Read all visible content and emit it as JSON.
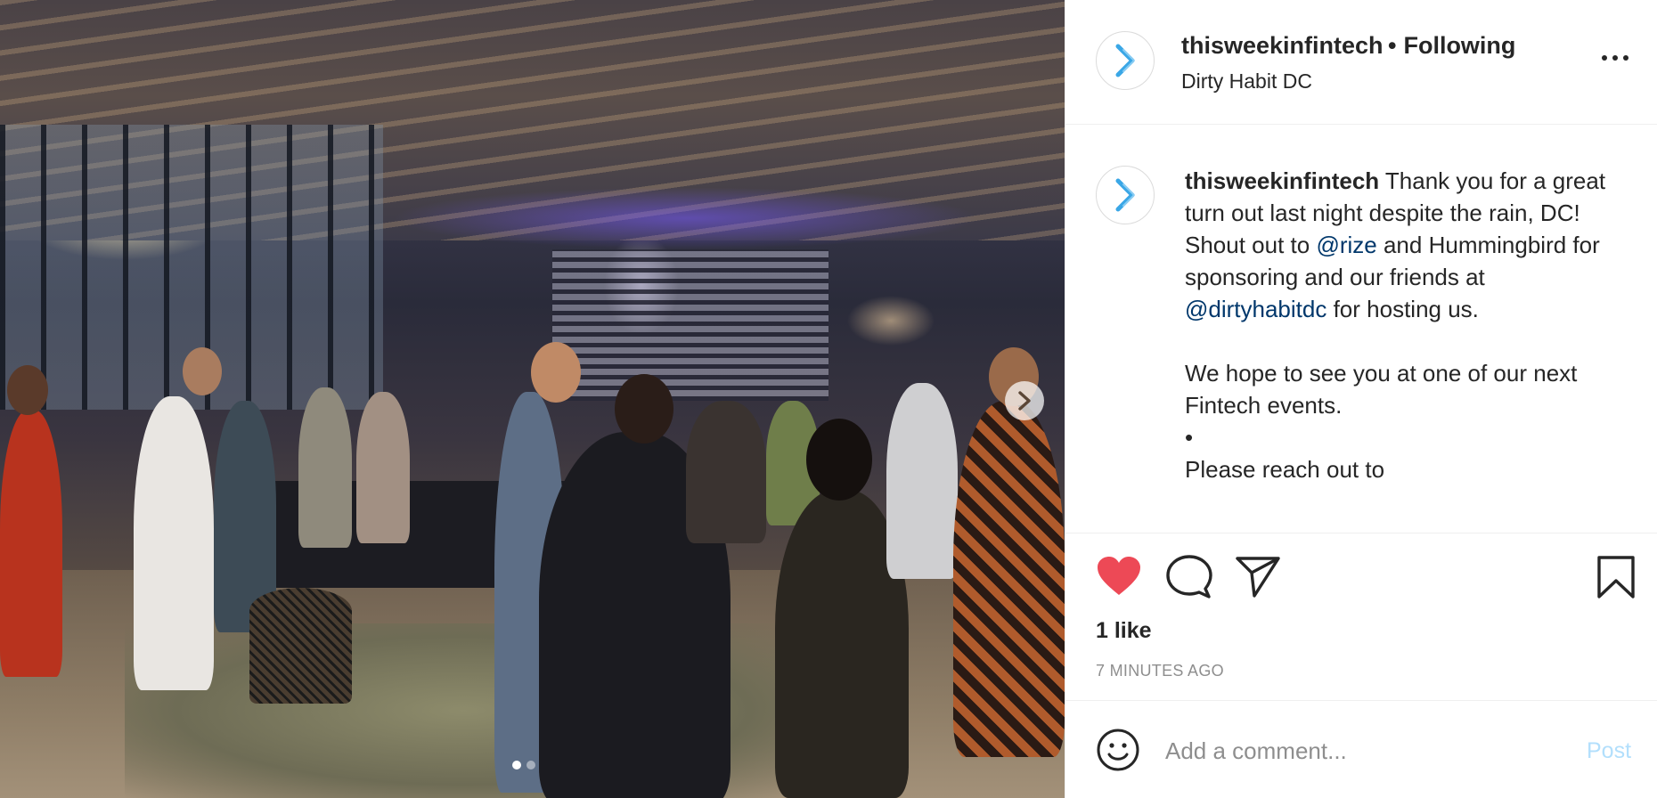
{
  "post": {
    "photo": {
      "alt": "photo",
      "carousel_count": 2,
      "carousel_active_index": 0
    },
    "header": {
      "username": "thisweekinfintech",
      "separator": "•",
      "follow_status": "Following",
      "location": "Dirty Habit DC"
    },
    "caption": {
      "username": "thisweekinfintech",
      "text_1": " Thank you for a great turn out last night despite the rain, DC! Shout out to ",
      "mention_1": "@rize",
      "text_2": " and Hummingbird for sponsoring and our friends at ",
      "mention_2": "@dirtyhabitdc",
      "text_3": " for hosting us.\n\nWe hope to see you at one of our next Fintech events.\n•\nPlease reach out to"
    },
    "actions": {
      "likes": "1 like",
      "timestamp": "7 MINUTES AGO",
      "liked": true,
      "like_color": "#ed4956"
    },
    "comment": {
      "placeholder": "Add a comment...",
      "post_label": "Post",
      "post_color": "#b2dffc"
    },
    "icons": {
      "avatar": "chevron-right-logo-icon",
      "more": "more-options-icon",
      "like": "heart-icon",
      "comment": "comment-bubble-icon",
      "share": "paper-plane-icon",
      "save": "bookmark-icon",
      "emoji": "smiley-icon",
      "next": "chevron-right-icon"
    }
  }
}
